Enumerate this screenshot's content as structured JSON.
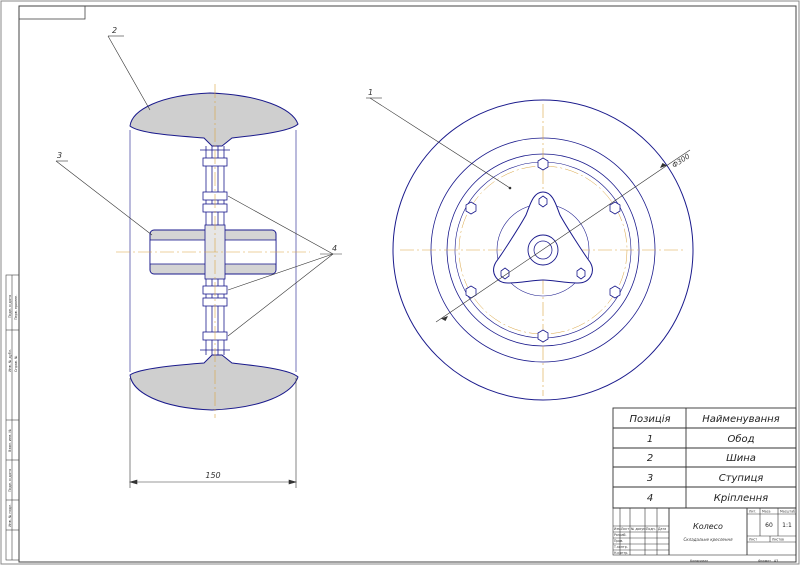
{
  "drawing": {
    "leaders": {
      "tire": "2",
      "hub": "3",
      "fasteners": "4",
      "rim": "1"
    },
    "dimension_width": "150",
    "dimension_diameter": "Ф300"
  },
  "spec_table": {
    "header_position": "Позиція",
    "header_name": "Найменування",
    "rows": [
      {
        "pos": "1",
        "name": "Обод"
      },
      {
        "pos": "2",
        "name": "Шина"
      },
      {
        "pos": "3",
        "name": "Ступиця"
      },
      {
        "pos": "4",
        "name": "Кріплення"
      }
    ]
  },
  "title_block": {
    "title": "Колесо",
    "subtitle": "Складальне креслення",
    "mass": "60",
    "scale": "1:1",
    "col_lit": "Лит.",
    "col_mass": "Маса",
    "col_scale": "Масштаб",
    "sheet": "Лист",
    "sheets": "Листов",
    "copied": "Копировал",
    "format": "Формат",
    "format_value": "A3",
    "roles": [
      "Разраб.",
      "Пров.",
      "Т.контр.",
      "",
      "Н.контр.",
      "Утв."
    ],
    "change_headers": [
      "Изм.",
      "Лист",
      "№ докум.",
      "Подп.",
      "Дата"
    ]
  },
  "side_strip": [
    "Подп. и дата",
    "Инв. № дубл.",
    "Взам. инв. №",
    "Подп. и дата",
    "Инв. № подл.",
    "Справ. №",
    "Перв. примен."
  ],
  "colors": {
    "line": "#1a1a8c",
    "hatch": "#c8c8c8",
    "axis": "#d9a441",
    "frame": "#555555"
  }
}
